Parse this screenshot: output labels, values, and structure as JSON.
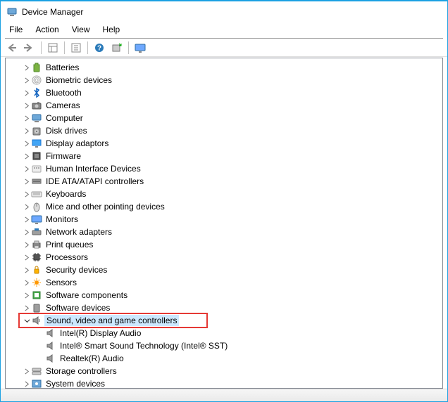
{
  "window": {
    "title": "Device Manager"
  },
  "menu": {
    "file": "File",
    "action": "Action",
    "view": "View",
    "help": "Help"
  },
  "tree": {
    "categories": [
      {
        "label": "Batteries",
        "icon": "battery"
      },
      {
        "label": "Biometric devices",
        "icon": "fingerprint"
      },
      {
        "label": "Bluetooth",
        "icon": "bluetooth"
      },
      {
        "label": "Cameras",
        "icon": "camera"
      },
      {
        "label": "Computer",
        "icon": "computer"
      },
      {
        "label": "Disk drives",
        "icon": "disk"
      },
      {
        "label": "Display adaptors",
        "icon": "display"
      },
      {
        "label": "Firmware",
        "icon": "firmware"
      },
      {
        "label": "Human Interface Devices",
        "icon": "hid"
      },
      {
        "label": "IDE ATA/ATAPI controllers",
        "icon": "ide"
      },
      {
        "label": "Keyboards",
        "icon": "keyboard"
      },
      {
        "label": "Mice and other pointing devices",
        "icon": "mouse"
      },
      {
        "label": "Monitors",
        "icon": "monitor"
      },
      {
        "label": "Network adapters",
        "icon": "network"
      },
      {
        "label": "Print queues",
        "icon": "printer"
      },
      {
        "label": "Processors",
        "icon": "cpu"
      },
      {
        "label": "Security devices",
        "icon": "security"
      },
      {
        "label": "Sensors",
        "icon": "sensor"
      },
      {
        "label": "Software components",
        "icon": "swcomp"
      },
      {
        "label": "Software devices",
        "icon": "swdev"
      }
    ],
    "expanded": {
      "label": "Sound, video and game controllers",
      "icon": "sound",
      "children": [
        {
          "label": "Intel(R) Display Audio",
          "icon": "speaker"
        },
        {
          "label": "Intel® Smart Sound Technology (Intel® SST)",
          "icon": "speaker"
        },
        {
          "label": "Realtek(R) Audio",
          "icon": "speaker"
        }
      ]
    },
    "tail": [
      {
        "label": "Storage controllers",
        "icon": "storage"
      },
      {
        "label": "System devices",
        "icon": "system"
      }
    ]
  }
}
